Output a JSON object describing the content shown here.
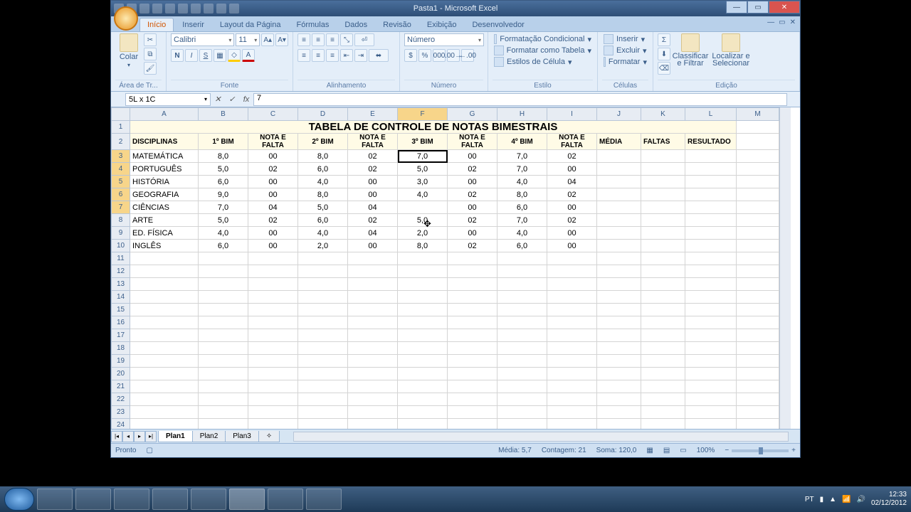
{
  "app": {
    "title": "Pasta1 - Microsoft Excel"
  },
  "tabs": [
    "Início",
    "Inserir",
    "Layout da Página",
    "Fórmulas",
    "Dados",
    "Revisão",
    "Exibição",
    "Desenvolvedor"
  ],
  "ribbon": {
    "clipboard": {
      "paste": "Colar",
      "label": "Área de Tr..."
    },
    "font": {
      "name": "Calibri",
      "size": "11",
      "label": "Fonte"
    },
    "alignment": {
      "label": "Alinhamento"
    },
    "number": {
      "format": "Número",
      "label": "Número"
    },
    "styles": {
      "cond": "Formatação Condicional",
      "table": "Formatar como Tabela",
      "cell": "Estilos de Célula",
      "label": "Estilo"
    },
    "cells": {
      "insert": "Inserir",
      "delete": "Excluir",
      "format": "Formatar",
      "label": "Células"
    },
    "editing": {
      "sort": "Classificar e Filtrar",
      "find": "Localizar e Selecionar",
      "label": "Edição"
    }
  },
  "namebox": "5L x 1C",
  "formula": "7",
  "columns": [
    "A",
    "B",
    "C",
    "D",
    "E",
    "F",
    "G",
    "H",
    "I",
    "J",
    "K",
    "L",
    "M"
  ],
  "sheet": {
    "title": "TABELA DE CONTROLE DE NOTAS BIMESTRAIS",
    "headers": [
      "DISCIPLINAS",
      "1º BIM",
      "NOTA E FALTA",
      "2º BIM",
      "NOTA E FALTA",
      "3º BIM",
      "NOTA E FALTA",
      "4º BIM",
      "NOTA E FALTA",
      "MÉDIA",
      "FALTAS",
      "RESULTADO"
    ],
    "rows": [
      {
        "d": "MATEMÁTICA",
        "b1": "8,0",
        "f1": "00",
        "b2": "8,0",
        "f2": "02",
        "b3": "7,0",
        "f3": "00",
        "b4": "7,0",
        "f4": "02"
      },
      {
        "d": "PORTUGUÊS",
        "b1": "5,0",
        "f1": "02",
        "b2": "6,0",
        "f2": "02",
        "b3": "5,0",
        "f3": "02",
        "b4": "7,0",
        "f4": "00"
      },
      {
        "d": "HISTÓRIA",
        "b1": "6,0",
        "f1": "00",
        "b2": "4,0",
        "f2": "00",
        "b3": "3,0",
        "f3": "00",
        "b4": "4,0",
        "f4": "04"
      },
      {
        "d": "GEOGRAFIA",
        "b1": "9,0",
        "f1": "00",
        "b2": "8,0",
        "f2": "00",
        "b3": "4,0",
        "f3": "02",
        "b4": "8,0",
        "f4": "02"
      },
      {
        "d": "CIÊNCIAS",
        "b1": "7,0",
        "f1": "04",
        "b2": "5,0",
        "f2": "04",
        "b3": "",
        "f3": "00",
        "b4": "6,0",
        "f4": "00"
      },
      {
        "d": "ARTE",
        "b1": "5,0",
        "f1": "02",
        "b2": "6,0",
        "f2": "02",
        "b3": "5,0",
        "f3": "02",
        "b4": "7,0",
        "f4": "02"
      },
      {
        "d": "ED. FÍSICA",
        "b1": "4,0",
        "f1": "00",
        "b2": "4,0",
        "f2": "04",
        "b3": "2,0",
        "f3": "00",
        "b4": "4,0",
        "f4": "00",
        "red": true
      },
      {
        "d": "INGLÊS",
        "b1": "6,0",
        "f1": "00",
        "b2": "2,0",
        "f2": "00",
        "b3": "8,0",
        "f3": "02",
        "b4": "6,0",
        "f4": "00"
      }
    ]
  },
  "sheets": [
    "Plan1",
    "Plan2",
    "Plan3"
  ],
  "status": {
    "ready": "Pronto",
    "avg": "Média: 5,7",
    "count": "Contagem: 21",
    "sum": "Soma: 120,0",
    "zoom": "100%"
  },
  "tray": {
    "lang": "PT",
    "time": "12:33",
    "date": "02/12/2012"
  }
}
